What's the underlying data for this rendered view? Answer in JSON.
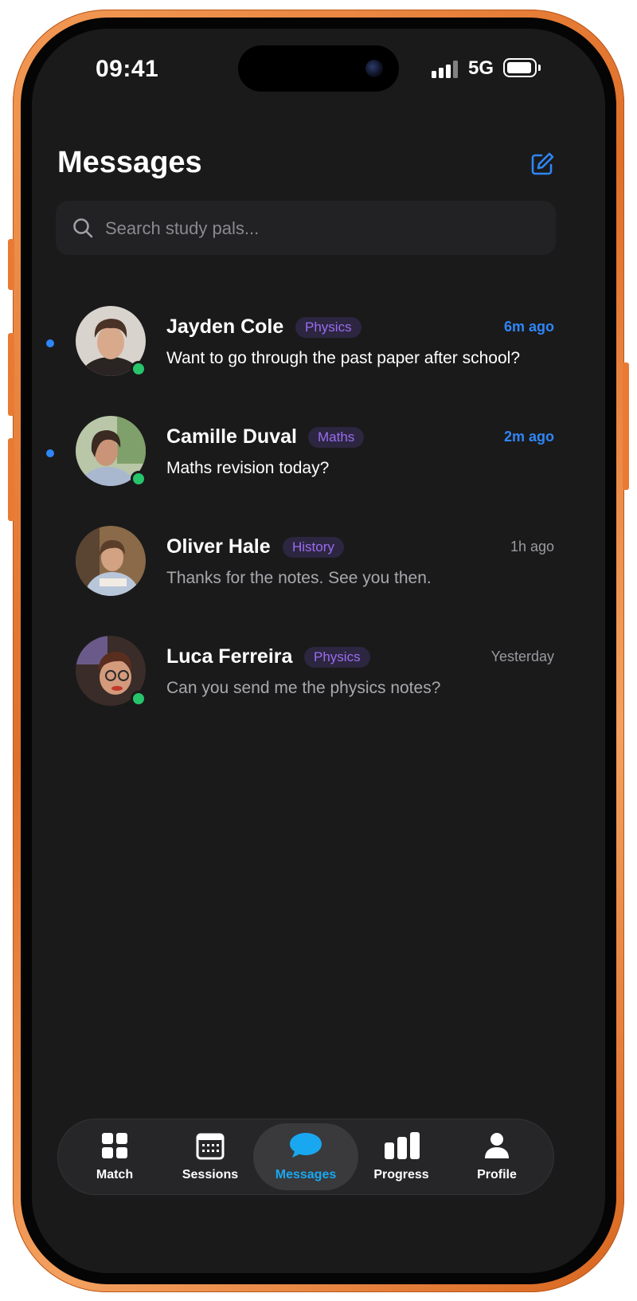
{
  "status_bar": {
    "time": "09:41",
    "network": "5G"
  },
  "header": {
    "title": "Messages"
  },
  "search": {
    "placeholder": "Search study pals..."
  },
  "chats": [
    {
      "name": "Jayden Cole",
      "subject": "Physics",
      "time": "6m ago",
      "preview": "Want to go through the past paper after school?",
      "unread": true,
      "online": true
    },
    {
      "name": "Camille Duval",
      "subject": "Maths",
      "time": "2m ago",
      "preview": "Maths revision today?",
      "unread": true,
      "online": true
    },
    {
      "name": "Oliver Hale",
      "subject": "History",
      "time": "1h ago",
      "preview": "Thanks for the notes. See you then.",
      "unread": false,
      "online": false
    },
    {
      "name": "Luca Ferreira",
      "subject": "Physics",
      "time": "Yesterday",
      "preview": "Can you send me the physics notes?",
      "unread": false,
      "online": true
    }
  ],
  "tabs": [
    {
      "label": "Match",
      "icon": "grid-icon",
      "active": false
    },
    {
      "label": "Sessions",
      "icon": "calendar-icon",
      "active": false
    },
    {
      "label": "Messages",
      "icon": "chat-bubble-icon",
      "active": true
    },
    {
      "label": "Progress",
      "icon": "bar-chart-icon",
      "active": false
    },
    {
      "label": "Profile",
      "icon": "person-icon",
      "active": false
    }
  ],
  "colors": {
    "accent_blue": "#2f86f6",
    "tab_active": "#19a8f0",
    "tag_purple": "#9b6cf0",
    "online_green": "#27c46b",
    "background": "#1a1a1b",
    "frame_orange": "#e97a34"
  }
}
